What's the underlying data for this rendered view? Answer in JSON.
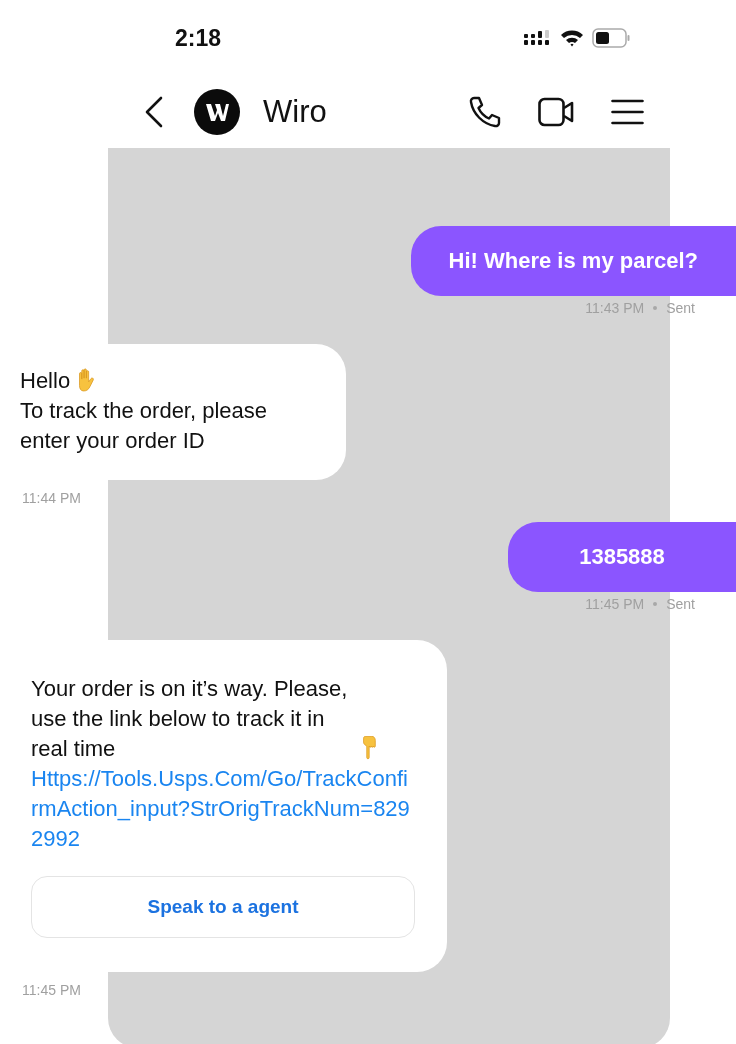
{
  "status_bar": {
    "time": "2:18"
  },
  "header": {
    "contact_name": "Wiro"
  },
  "messages": [
    {
      "kind": "outgoing",
      "text": "Hi! Where is my parcel?",
      "time": "11:43 PM",
      "status": "Sent"
    },
    {
      "kind": "incoming",
      "paragraphs": [
        {
          "kind": "text",
          "text": "Hello",
          "emoji": true
        },
        {
          "kind": "text",
          "text": "To track the order, please enter your order ID",
          "emoji": false
        }
      ],
      "time": "11:44 PM"
    },
    {
      "kind": "outgoing",
      "text": "1385888",
      "time": "11:45 PM",
      "status": "Sent"
    },
    {
      "kind": "incoming",
      "paragraphs": [
        {
          "kind": "text",
          "text": "Your order is on it’s way. Please, use the link below to track it in real time",
          "emoji": true
        },
        {
          "kind": "link",
          "text": "Https://Tools.Usps.Com/Go/TrackConfirmAction_input?StrOrigTrackNum=8292992"
        }
      ],
      "button": "Speak to a agent",
      "time": "11:45 PM"
    }
  ]
}
